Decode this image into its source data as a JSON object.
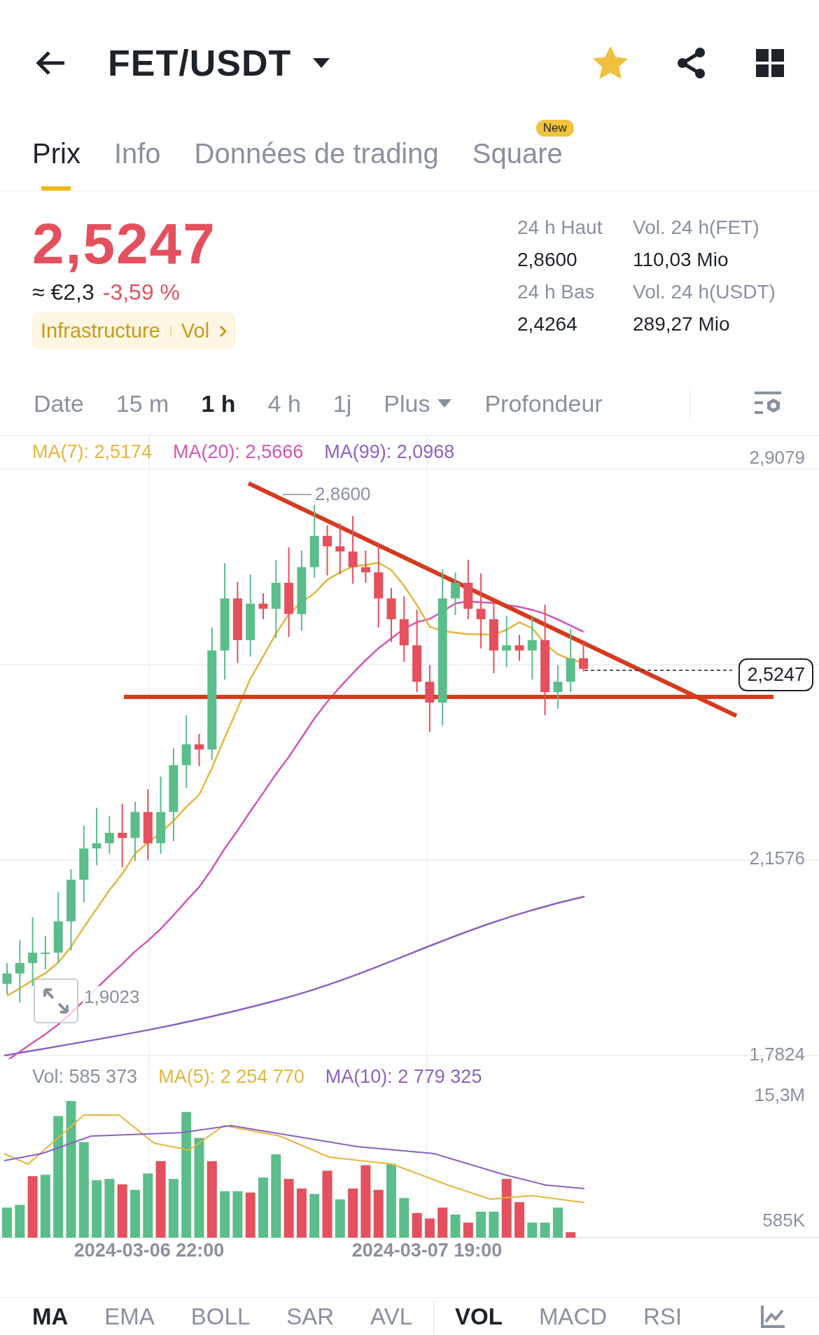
{
  "header": {
    "title": "FET/USDT",
    "favorite": true
  },
  "tabs": [
    {
      "label": "Prix",
      "selected": true
    },
    {
      "label": "Info",
      "selected": false
    },
    {
      "label": "Données de trading",
      "selected": false
    },
    {
      "label": "Square",
      "selected": false,
      "badge": "New"
    }
  ],
  "price": {
    "last": "2,5247",
    "fiat": "≈ €2,3",
    "change": "-3,59 %",
    "tags": [
      "Infrastructure",
      "Vol"
    ]
  },
  "stats": [
    {
      "label": "24 h Haut",
      "value": "2,8600"
    },
    {
      "label": "Vol. 24 h(FET)",
      "value": "110,03 Mio"
    },
    {
      "label": "24 h Bas",
      "value": "2,4264"
    },
    {
      "label": "Vol. 24 h(USDT)",
      "value": "289,27 Mio"
    }
  ],
  "timeframes": [
    {
      "label": "Date",
      "selected": false
    },
    {
      "label": "15 m",
      "selected": false
    },
    {
      "label": "1 h",
      "selected": true
    },
    {
      "label": "4 h",
      "selected": false
    },
    {
      "label": "1j",
      "selected": false
    },
    {
      "label": "Plus",
      "selected": false,
      "dropdown": true
    },
    {
      "label": "Profondeur",
      "selected": false
    }
  ],
  "ma_legend": [
    {
      "label": "MA(7): 2,5174",
      "color": "#e4b73c"
    },
    {
      "label": "MA(20): 2,5666",
      "color": "#d256b6"
    },
    {
      "label": "MA(99): 2,0968",
      "color": "#8b62c0"
    }
  ],
  "price_axis": [
    "2,9079",
    "2,1576",
    "1,7824"
  ],
  "last_price_label": "2,5247",
  "high_marker": "2,8600",
  "low_marker": "1,9023",
  "vol_legend": [
    {
      "label": "Vol: 585 373",
      "color": "#8a919e"
    },
    {
      "label": "MA(5): 2 254 770",
      "color": "#e4b73c"
    },
    {
      "label": "MA(10): 2 779 325",
      "color": "#8b62c0"
    }
  ],
  "vol_axis": [
    "15,3M",
    "585K"
  ],
  "dates": [
    "2024-03-06 22:00",
    "2024-03-07 19:00"
  ],
  "main_indicators": [
    {
      "label": "MA",
      "selected": true
    },
    {
      "label": "EMA",
      "selected": false
    },
    {
      "label": "BOLL",
      "selected": false
    },
    {
      "label": "SAR",
      "selected": false
    },
    {
      "label": "AVL",
      "selected": false
    }
  ],
  "sub_indicators": [
    {
      "label": "VOL",
      "selected": true
    },
    {
      "label": "MACD",
      "selected": false
    },
    {
      "label": "RSI",
      "selected": false
    }
  ]
}
